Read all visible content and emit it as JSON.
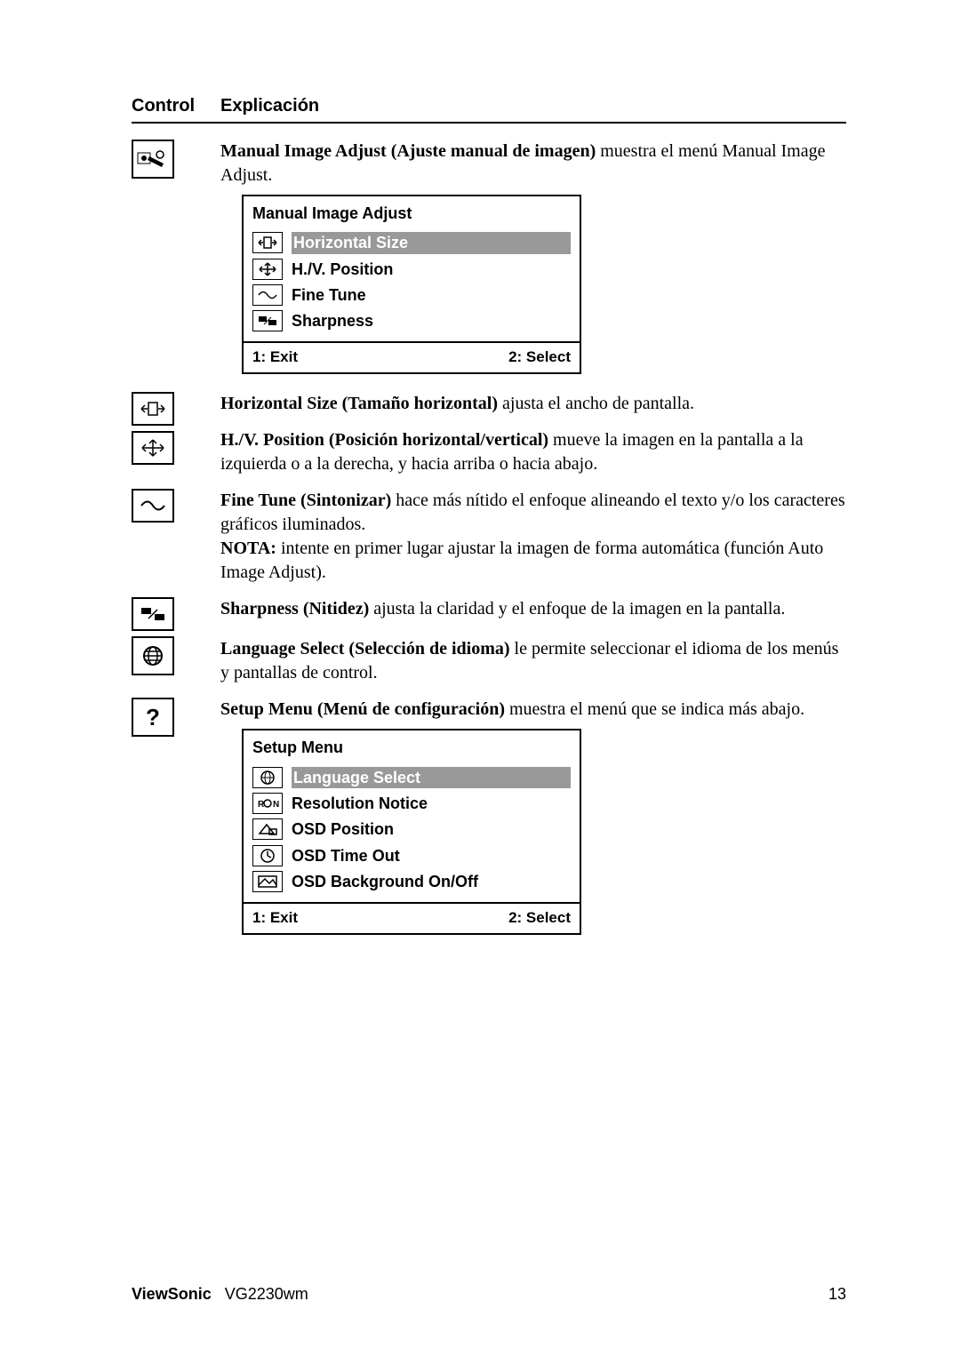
{
  "headers": {
    "control": "Control",
    "explicacion": "Explicación"
  },
  "entries": {
    "manual_image_adjust": {
      "bold": "Manual Image Adjust (Ajuste manual de imagen)",
      "rest": "  muestra el menú Manual Image Adjust."
    },
    "horizontal_size": {
      "bold": "Horizontal Size (Tamaño horizontal)",
      "rest": " ajusta el ancho de pantalla."
    },
    "hv_position": {
      "bold": "H./V. Position (Posición horizontal/vertical)",
      "rest": " mueve la imagen en la pantalla a la izquierda o a la derecha, y hacia arriba o hacia abajo."
    },
    "fine_tune": {
      "bold": "Fine Tune (Sintonizar)",
      "rest": " hace más nítido el enfoque alineando el texto y/o los caracteres gráficos iluminados.",
      "nota_bold": "NOTA:",
      "nota_rest": " intente en primer lugar ajustar la imagen de forma automática (función Auto Image Adjust)."
    },
    "sharpness": {
      "bold": "Sharpness (Nitidez)",
      "rest": " ajusta la claridad y el enfoque de la imagen en la pantalla."
    },
    "language_select": {
      "bold": "Language Select (Selección de idioma)",
      "rest": " le permite seleccionar el idioma de los menús y pantallas de control."
    },
    "setup_menu": {
      "bold": "Setup Menu (Menú de configuración)",
      "rest": " muestra el menú que se indica más abajo."
    }
  },
  "menu1": {
    "title": "Manual Image Adjust",
    "items": [
      {
        "label": "Horizontal Size"
      },
      {
        "label": "H./V. Position"
      },
      {
        "label": "Fine Tune"
      },
      {
        "label": "Sharpness"
      }
    ],
    "exit": "1: Exit",
    "select": "2: Select"
  },
  "menu2": {
    "title": "Setup Menu",
    "items": [
      {
        "label": "Language Select"
      },
      {
        "label": "Resolution Notice"
      },
      {
        "label": "OSD Position"
      },
      {
        "label": "OSD Time Out"
      },
      {
        "label": "OSD Background On/Off"
      }
    ],
    "exit": "1: Exit",
    "select": "2: Select"
  },
  "footer": {
    "brand": "ViewSonic",
    "model": "VG2230wm",
    "page": "13"
  }
}
